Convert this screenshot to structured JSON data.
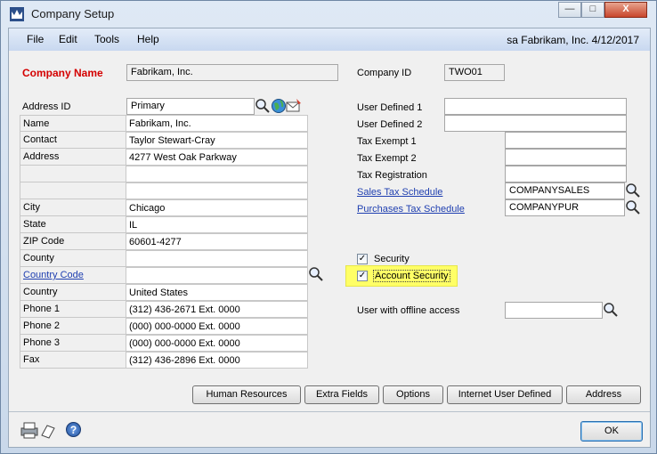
{
  "window": {
    "title": "Company Setup",
    "minimize": "—",
    "maximize": "□",
    "close": "X"
  },
  "menu": {
    "file": "File",
    "edit": "Edit",
    "tools": "Tools",
    "help": "Help"
  },
  "user_info": "sa  Fabrikam, Inc.  4/12/2017",
  "company": {
    "name_label": "Company Name",
    "name_value": "Fabrikam, Inc.",
    "id_label": "Company ID",
    "id_value": "TWO01"
  },
  "address": {
    "address_id_label": "Address ID",
    "address_id_value": "Primary",
    "rows": [
      {
        "label": "Name",
        "value": "Fabrikam, Inc."
      },
      {
        "label": "Contact",
        "value": "Taylor Stewart-Cray"
      },
      {
        "label": "Address",
        "value": "4277 West Oak Parkway"
      },
      {
        "label": "",
        "value": ""
      },
      {
        "label": "",
        "value": ""
      },
      {
        "label": "City",
        "value": "Chicago"
      },
      {
        "label": "State",
        "value": "IL"
      },
      {
        "label": "ZIP Code",
        "value": "60601-4277"
      },
      {
        "label": "County",
        "value": ""
      },
      {
        "label": "Country Code",
        "value": ""
      },
      {
        "label": "Country",
        "value": "United States"
      },
      {
        "label": "Phone 1",
        "value": "(312) 436-2671  Ext. 0000"
      },
      {
        "label": "Phone 2",
        "value": "(000) 000-0000  Ext. 0000"
      },
      {
        "label": "Phone 3",
        "value": "(000) 000-0000  Ext. 0000"
      },
      {
        "label": "Fax",
        "value": "(312) 436-2896  Ext. 0000"
      }
    ]
  },
  "right": {
    "user_defined_1": "User Defined 1",
    "user_defined_2": "User Defined 2",
    "tax_exempt_1": "Tax Exempt 1",
    "tax_exempt_2": "Tax Exempt 2",
    "tax_registration": "Tax Registration",
    "sales_tax_label": "Sales Tax Schedule",
    "sales_tax_value": "COMPANYSALES",
    "purchases_tax_label": "Purchases Tax Schedule",
    "purchases_tax_value": "COMPANYPUR",
    "security_label": "Security",
    "security_checked": "✓",
    "account_security_label": "Account Security",
    "account_security_checked": "✓",
    "offline_access_label": "User with offline access",
    "offline_access_value": ""
  },
  "buttons": {
    "human_resources": "Human Resources",
    "extra_fields": "Extra Fields",
    "options": "Options",
    "internet_user_defined": "Internet User Defined",
    "address": "Address",
    "ok": "OK"
  },
  "footer": {
    "help": "?"
  },
  "colors": {
    "highlight": "#ffff66",
    "required_label": "#d40000",
    "link": "#1f3fb0"
  }
}
